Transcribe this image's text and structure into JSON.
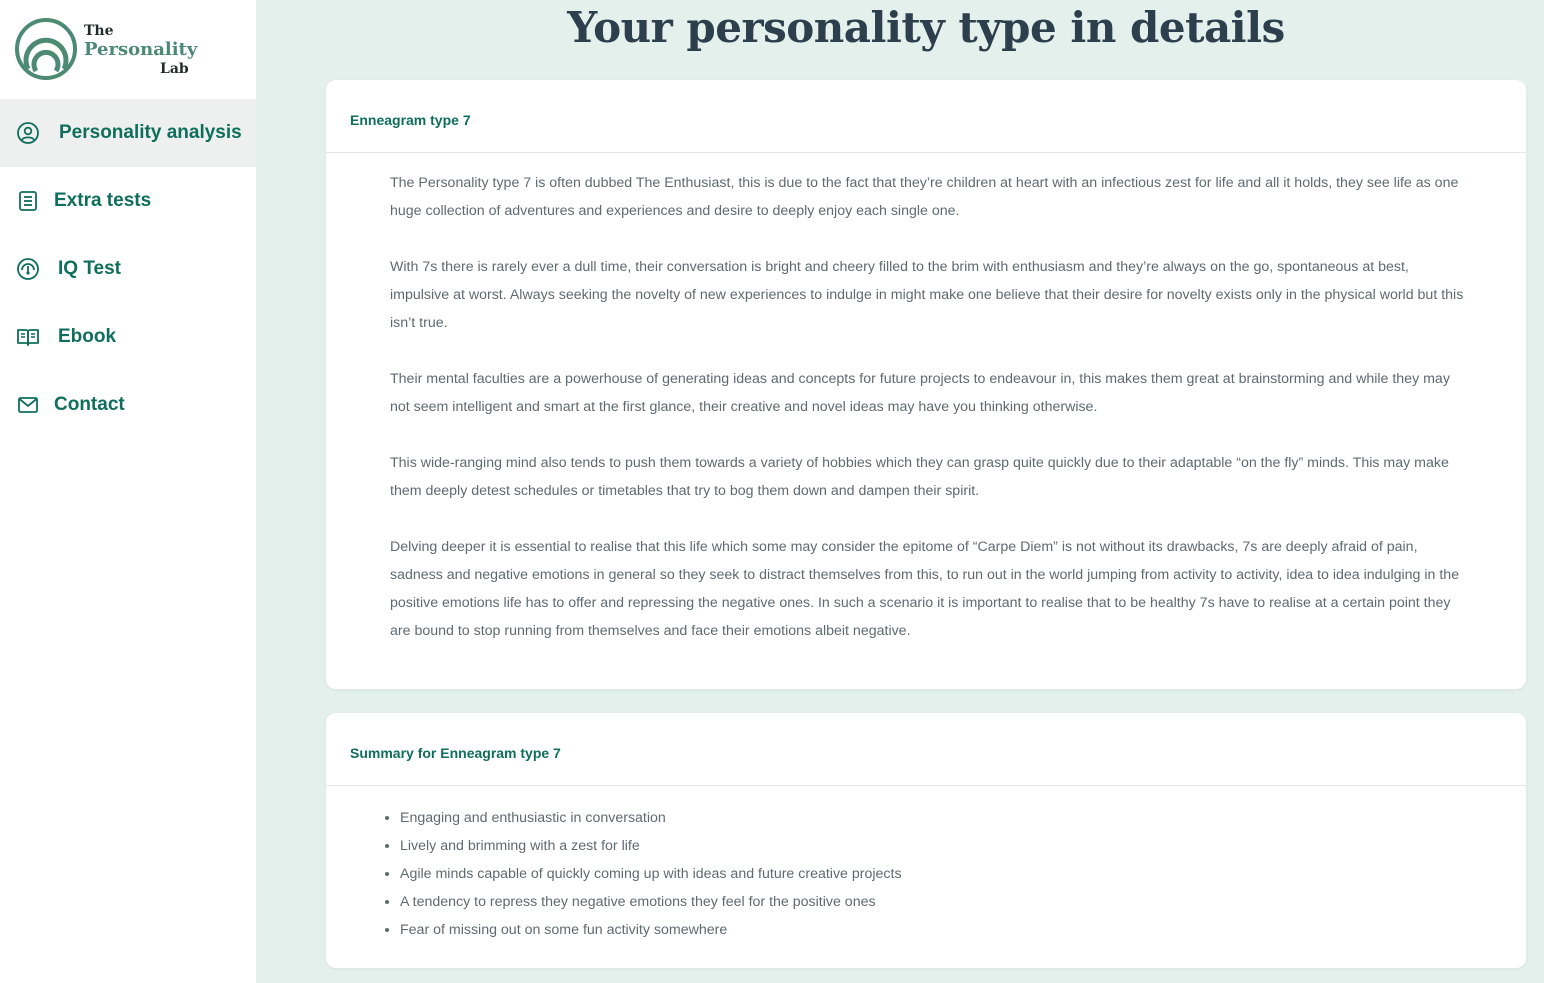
{
  "brand": {
    "line1": "The",
    "line2": "Personality",
    "line3": "Lab",
    "colors": {
      "primary": "#0f6e5c",
      "logo_green": "#4c8a74",
      "background": "#e3f0ec"
    }
  },
  "sidebar": {
    "items": [
      {
        "label": "Personality analysis",
        "icon": "user-circle-icon",
        "active": true
      },
      {
        "label": "Extra tests",
        "icon": "list-document-icon",
        "active": false
      },
      {
        "label": "IQ Test",
        "icon": "gauge-icon",
        "active": false
      },
      {
        "label": "Ebook",
        "icon": "open-book-icon",
        "active": false
      },
      {
        "label": "Contact",
        "icon": "envelope-icon",
        "active": false
      }
    ]
  },
  "main": {
    "title": "Your personality type in details",
    "details_card": {
      "title": "Enneagram type 7",
      "paragraphs": [
        "The Personality type 7 is often dubbed The Enthusiast, this is due to the fact that they’re children at heart with an infectious zest for life and all it holds, they see life as one huge collection of adventures and experiences and desire to deeply enjoy each single one.",
        "With 7s there is rarely ever a dull time, their conversation is bright and cheery filled to the brim with enthusiasm and they’re always on the go, spontaneous at best, impulsive at worst. Always seeking the novelty of new experiences to indulge in might make one believe that their desire for novelty exists only in the physical world but this isn’t true.",
        "Their mental faculties are a powerhouse of generating ideas and concepts for future projects to endeavour in, this makes them great at brainstorming and while they may not seem intelligent and smart at the first glance, their creative and novel ideas may have you thinking otherwise.",
        "This wide-ranging mind also tends to push them towards a variety of hobbies which they can grasp quite quickly due to their adaptable “on the fly” minds. This may make them deeply detest schedules or timetables that try to bog them down and dampen their spirit.",
        "Delving deeper it is essential to realise that this life which some may consider the epitome of “Carpe Diem” is not without its drawbacks, 7s are deeply afraid of pain, sadness and negative emotions in general so they seek to distract themselves from this, to run out in the world jumping from activity to activity, idea to idea indulging in the positive emotions life has to offer and repressing the negative ones. In such a scenario it is important to realise that to be healthy 7s have to realise at a certain point they are bound to stop running from themselves and face their emotions albeit negative."
      ]
    },
    "summary_card": {
      "title": "Summary for Enneagram type 7",
      "items": [
        "Engaging and enthusiastic in conversation",
        "Lively and brimming with a zest for life",
        "Agile minds capable of quickly coming up with ideas and future creative projects",
        "A tendency to repress they negative emotions they feel for the positive ones",
        "Fear of missing out on some fun activity somewhere"
      ]
    }
  }
}
